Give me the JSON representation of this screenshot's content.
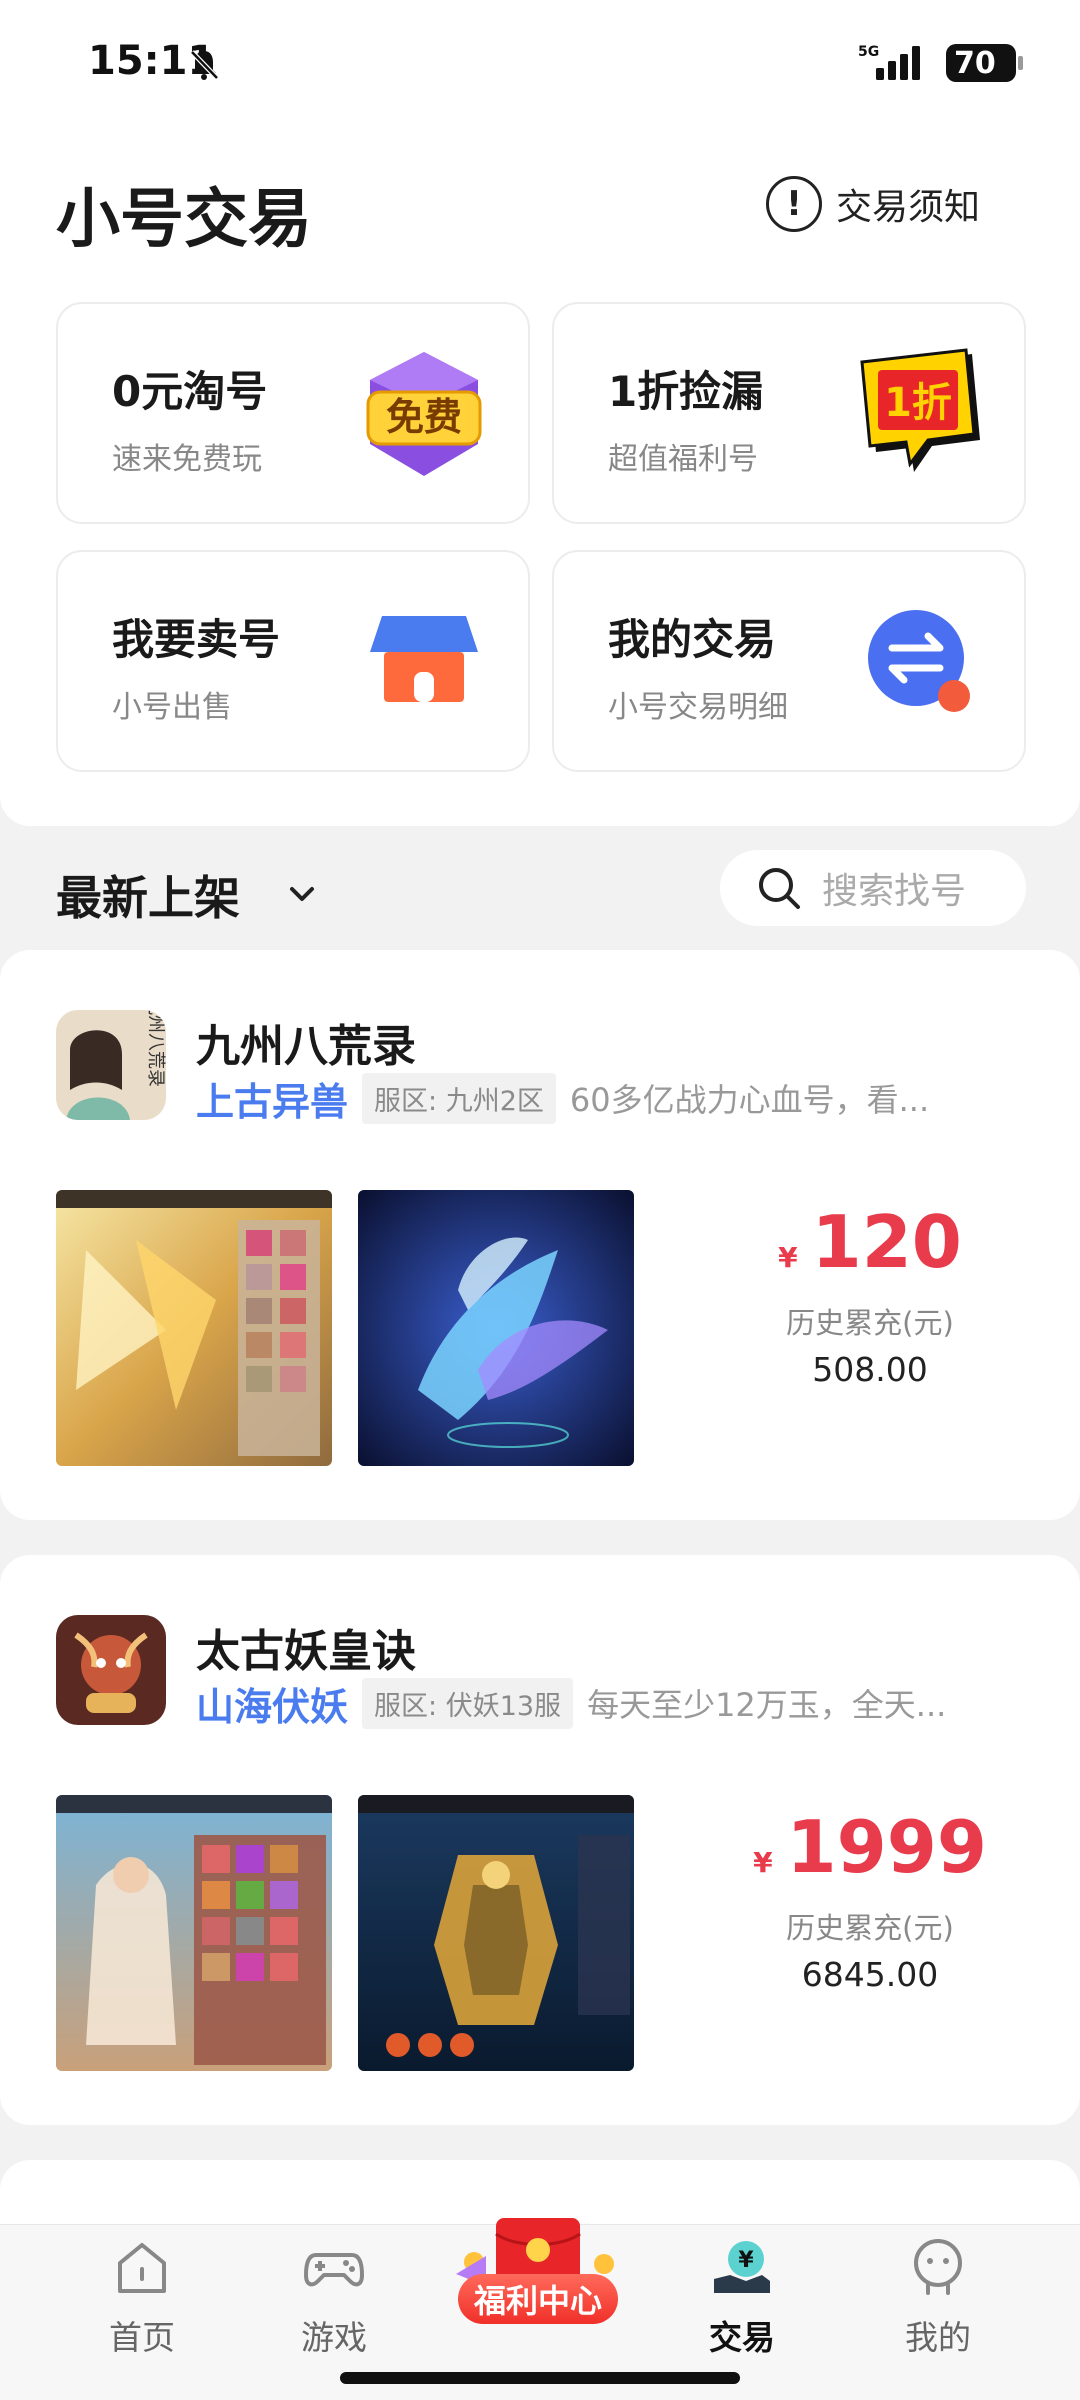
{
  "status": {
    "time": "15:11",
    "network": "5G",
    "battery": "70"
  },
  "header": {
    "title": "小号交易",
    "notice_label": "交易须知",
    "notice_icon": "info-icon"
  },
  "cards": [
    {
      "title": "0元淘号",
      "subtitle": "速来免费玩",
      "icon": "free-badge-icon",
      "icon_text": "免费"
    },
    {
      "title": "1折捡漏",
      "subtitle": "超值福利号",
      "icon": "discount-flag-icon",
      "icon_text": "1折"
    },
    {
      "title": "我要卖号",
      "subtitle": "小号出售",
      "icon": "shop-icon"
    },
    {
      "title": "我的交易",
      "subtitle": "小号交易明细",
      "icon": "exchange-icon"
    }
  ],
  "section": {
    "title": "最新上架",
    "search_placeholder": "搜索找号"
  },
  "listings": [
    {
      "game": "九州八荒录",
      "icon_text": "九州八荒录",
      "tag": "上古异兽",
      "server": "服区: 九州2区",
      "desc": "60多亿战力心血号，看...",
      "price_symbol": "¥",
      "price": "120",
      "history_label": "历史累充(元)",
      "history_value": "508.00"
    },
    {
      "game": "太古妖皇诀",
      "tag": "山海伏妖",
      "server": "服区: 伏妖13服",
      "desc": "每天至少12万玉，全天...",
      "price_symbol": "¥",
      "price": "1999",
      "history_label": "历史累充(元)",
      "history_value": "6845.00"
    }
  ],
  "tabbar": {
    "tabs": [
      {
        "label": "首页",
        "icon": "home-icon"
      },
      {
        "label": "游戏",
        "icon": "gamepad-icon"
      },
      {
        "label": "福利中心",
        "icon": "red-envelope-icon"
      },
      {
        "label": "交易",
        "icon": "trade-icon",
        "active": true
      },
      {
        "label": "我的",
        "icon": "profile-icon"
      }
    ]
  },
  "colors": {
    "accent_blue": "#4a7cf0",
    "price_red": "#e83b4b",
    "welfare_red": "#f0302a"
  }
}
